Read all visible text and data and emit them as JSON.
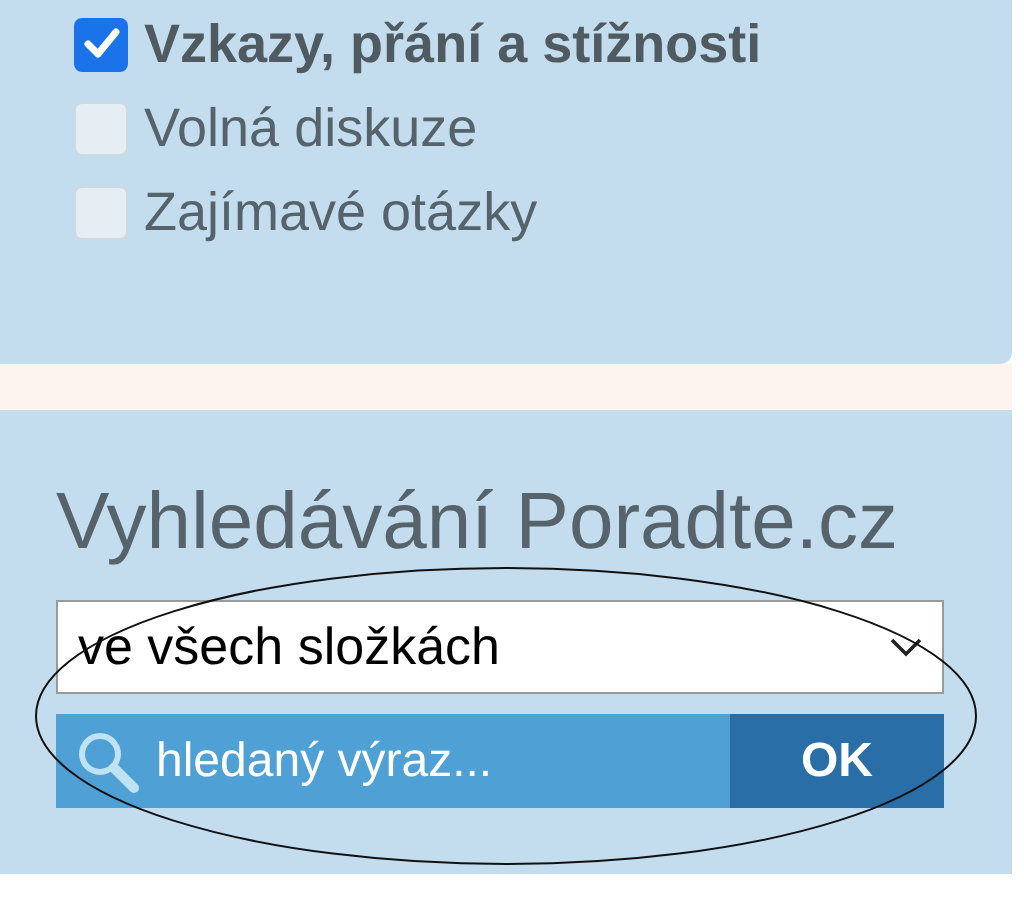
{
  "categories": [
    {
      "label": "Vzkazy, přání a stížnosti",
      "checked": true
    },
    {
      "label": "Volná diskuze",
      "checked": false
    },
    {
      "label": "Zajímavé otázky",
      "checked": false
    }
  ],
  "search": {
    "title": "Vyhledávání Poradte.cz",
    "scope": "ve všech složkách",
    "placeholder": "hledaný výraz...",
    "button": "OK"
  }
}
